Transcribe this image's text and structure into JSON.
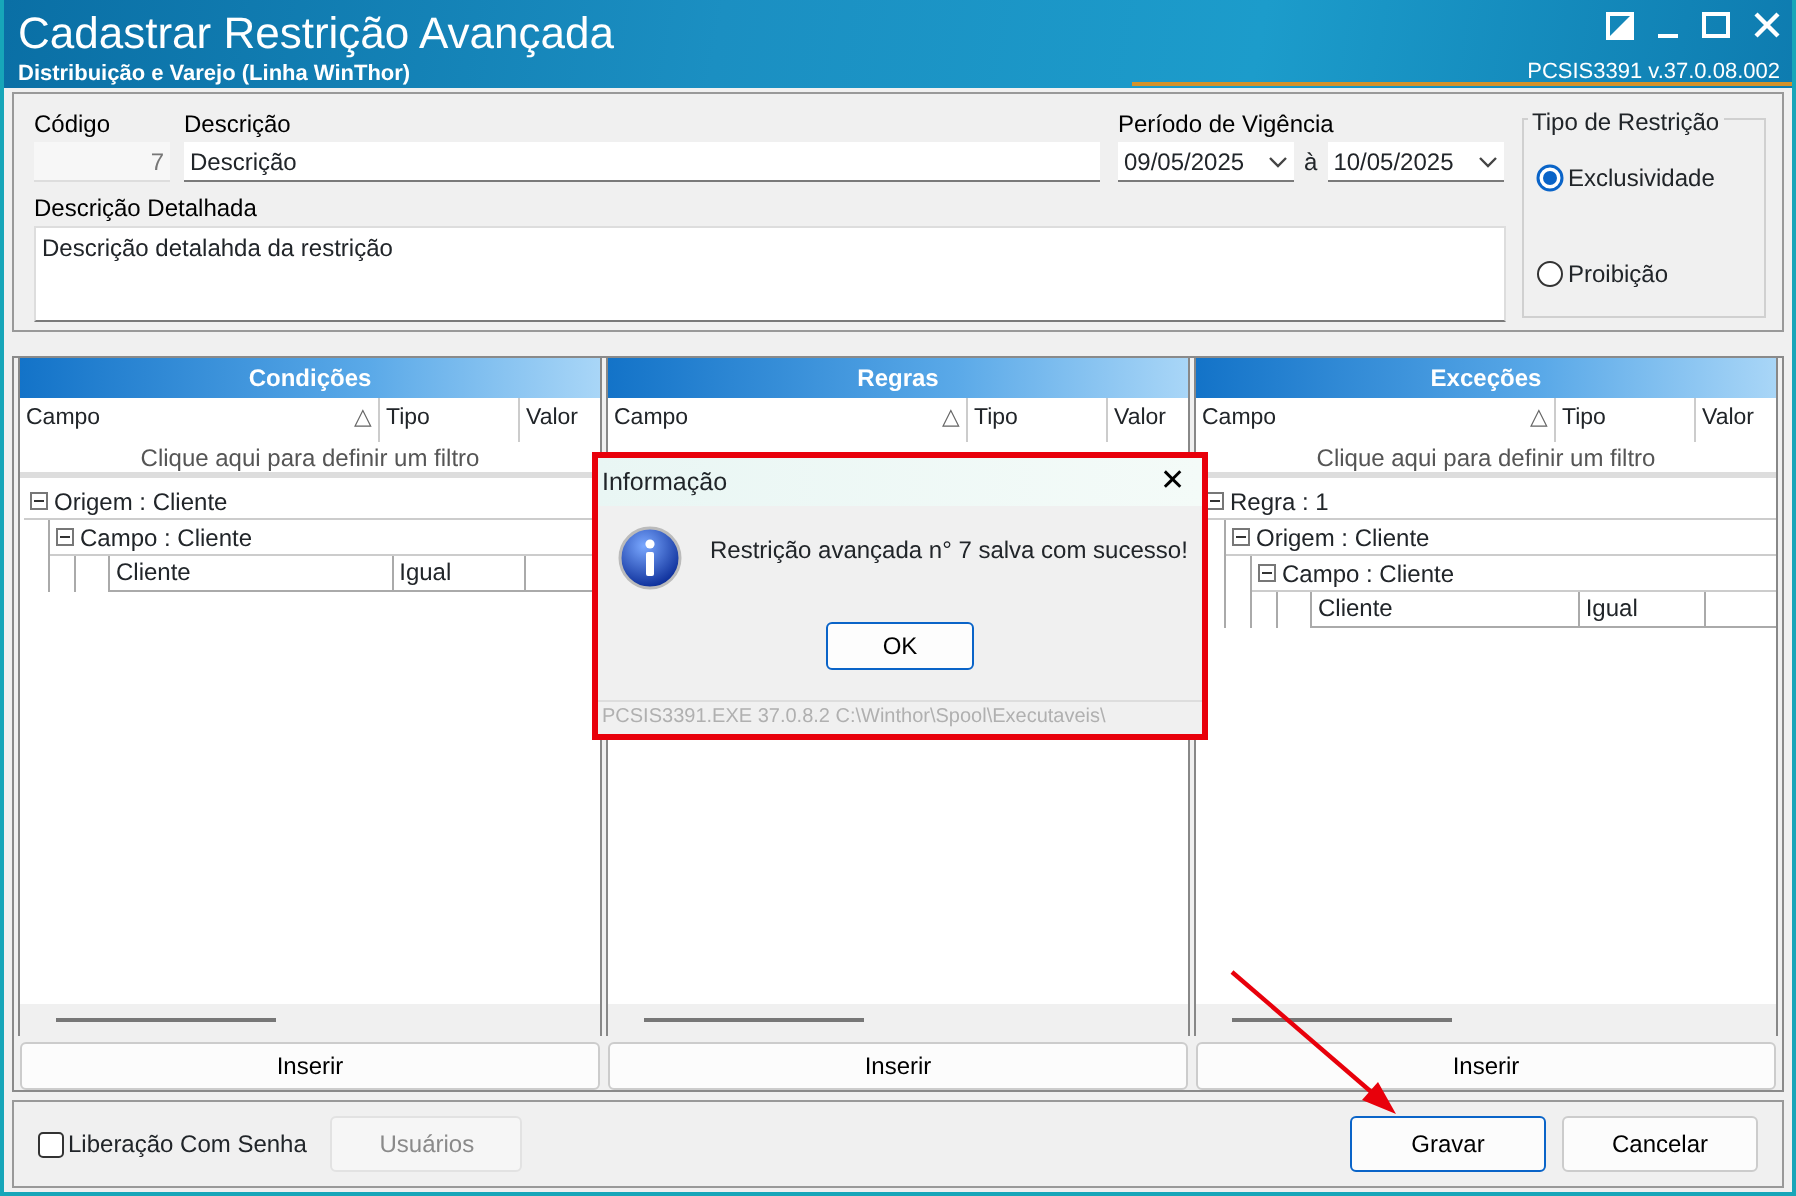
{
  "window": {
    "title": "Cadastrar Restrição Avançada",
    "subtitle": "Distribuição e Varejo (Linha WinThor)",
    "version": "PCSIS3391  v.37.0.08.002"
  },
  "form": {
    "codigo_label": "Código",
    "codigo": "7",
    "descricao_label": "Descrição",
    "descricao": "Descrição",
    "periodo_label": "Período de Vigência",
    "date_from": "09/05/2025",
    "date_sep": "à",
    "date_to": "10/05/2025",
    "detalhada_label": "Descrição Detalhada",
    "detalhada": "Descrição detalahda da restrição"
  },
  "tipo_restricao": {
    "title": "Tipo de Restrição",
    "options": [
      {
        "label": "Exclusividade",
        "selected": true
      },
      {
        "label": "Proibição",
        "selected": false
      }
    ]
  },
  "panels": [
    {
      "title": "Condições",
      "columns": [
        "Campo",
        "Tipo",
        "Valor"
      ],
      "sort_mark": "△",
      "filter_hint": "Clique aqui para definir um filtro",
      "tree": [
        {
          "label": "Origem : Cliente",
          "expanded": true,
          "children": [
            {
              "label": "Campo : Cliente",
              "expanded": true,
              "rows": [
                [
                  "Cliente",
                  "Igual"
                ]
              ]
            }
          ]
        }
      ],
      "button": "Inserir"
    },
    {
      "title": "Regras",
      "columns": [
        "Campo",
        "Tipo",
        "Valor"
      ],
      "sort_mark": "△",
      "button": "Inserir"
    },
    {
      "title": "Exceções",
      "columns": [
        "Campo",
        "Tipo",
        "Valor"
      ],
      "sort_mark": "△",
      "filter_hint": "Clique aqui para definir um filtro",
      "tree": [
        {
          "label": "Regra : 1",
          "expanded": true,
          "children": [
            {
              "label": "Origem : Cliente",
              "expanded": true,
              "children": [
                {
                  "label": "Campo : Cliente",
                  "expanded": true,
                  "rows": [
                    [
                      "Cliente",
                      "Igual"
                    ]
                  ]
                }
              ]
            }
          ]
        }
      ],
      "button": "Inserir"
    }
  ],
  "footer": {
    "liberacao": {
      "label": "Liberação Com Senha",
      "checked": false
    },
    "usuarios": {
      "label": "Usuários",
      "disabled": true
    },
    "gravar": "Gravar",
    "cancelar": "Cancelar"
  },
  "dialog": {
    "title": "Informação",
    "close": "✕",
    "message": "Restrição avançada n° 7 salva com sucesso!",
    "ok": "OK",
    "status": "PCSIS3391.EXE 37.0.8.2 C:\\Winthor\\Spool\\Executaveis\\",
    "highlighted": true
  },
  "annotation": {
    "arrow": true
  }
}
